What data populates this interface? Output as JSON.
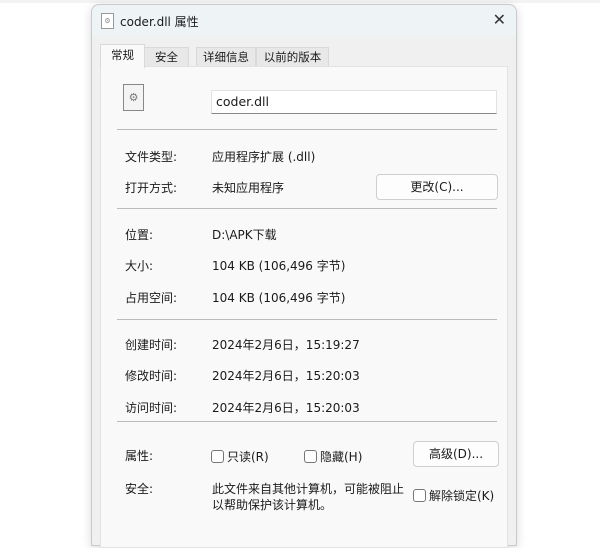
{
  "window": {
    "title": "coder.dll 属性",
    "close": "✕"
  },
  "tabs": [
    "常规",
    "安全",
    "详细信息",
    "以前的版本"
  ],
  "file_name": "coder.dll",
  "rows": {
    "type_label": "文件类型:",
    "type_value": "应用程序扩展 (.dll)",
    "open_label": "打开方式:",
    "open_value": "未知应用程序",
    "change_button": "更改(C)...",
    "location_label": "位置:",
    "location_value": "D:\\APK下载",
    "size_label": "大小:",
    "size_value": "104 KB (106,496 字节)",
    "disk_label": "占用空间:",
    "disk_value": "104 KB (106,496 字节)",
    "created_label": "创建时间:",
    "created_value": "2024年2月6日，15:19:27",
    "modified_label": "修改时间:",
    "modified_value": "2024年2月6日，15:20:03",
    "accessed_label": "访问时间:",
    "accessed_value": "2024年2月6日，15:20:03",
    "attr_label": "属性:",
    "readonly": "只读(R)",
    "hidden": "隐藏(H)",
    "advanced_button": "高级(D)...",
    "security_label": "安全:",
    "security_line1": "此文件来自其他计算机，可能被阻止",
    "security_line2": "以帮助保护该计算机。",
    "unblock": "解除锁定(K)"
  }
}
